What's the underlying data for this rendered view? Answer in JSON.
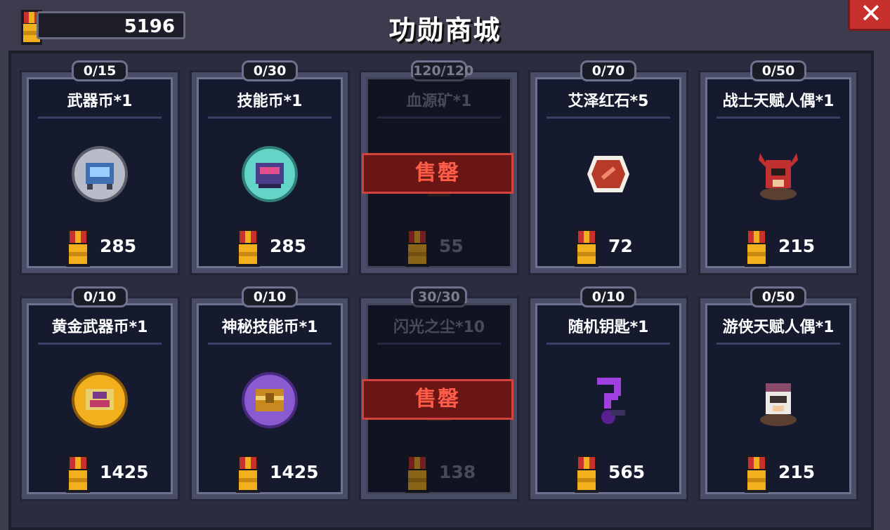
{
  "header": {
    "title": "功勋商城",
    "balance": "5196"
  },
  "colors": {
    "medal_gold": "#f2b01e",
    "medal_red": "#c8302e",
    "soldout_red": "#d2433e",
    "card_bg": "#161a2e"
  },
  "shop": {
    "items": [
      {
        "count": "0/15",
        "name": "武器币*1",
        "price": "285",
        "icon": "weapon-coin-icon",
        "sold_out": false
      },
      {
        "count": "0/30",
        "name": "技能币*1",
        "price": "285",
        "icon": "skill-coin-icon",
        "sold_out": false
      },
      {
        "count": "120/120",
        "name": "血源矿*1",
        "price": "55",
        "icon": "blood-ore-icon",
        "sold_out": true,
        "sold_label": "售罄"
      },
      {
        "count": "0/70",
        "name": "艾泽红石*5",
        "price": "72",
        "icon": "red-stone-icon",
        "sold_out": false
      },
      {
        "count": "0/50",
        "name": "战士天赋人偶*1",
        "price": "215",
        "icon": "warrior-doll-icon",
        "sold_out": false
      },
      {
        "count": "0/10",
        "name": "黄金武器币*1",
        "price": "1425",
        "icon": "gold-weapon-coin-icon",
        "sold_out": false
      },
      {
        "count": "0/10",
        "name": "神秘技能币*1",
        "price": "1425",
        "icon": "mystery-skill-coin-icon",
        "sold_out": false
      },
      {
        "count": "30/30",
        "name": "闪光之尘*10",
        "price": "138",
        "icon": "flash-dust-icon",
        "sold_out": true,
        "sold_label": "售罄"
      },
      {
        "count": "0/10",
        "name": "随机钥匙*1",
        "price": "565",
        "icon": "random-key-icon",
        "sold_out": false
      },
      {
        "count": "0/50",
        "name": "游侠天赋人偶*1",
        "price": "215",
        "icon": "ranger-doll-icon",
        "sold_out": false
      }
    ]
  }
}
